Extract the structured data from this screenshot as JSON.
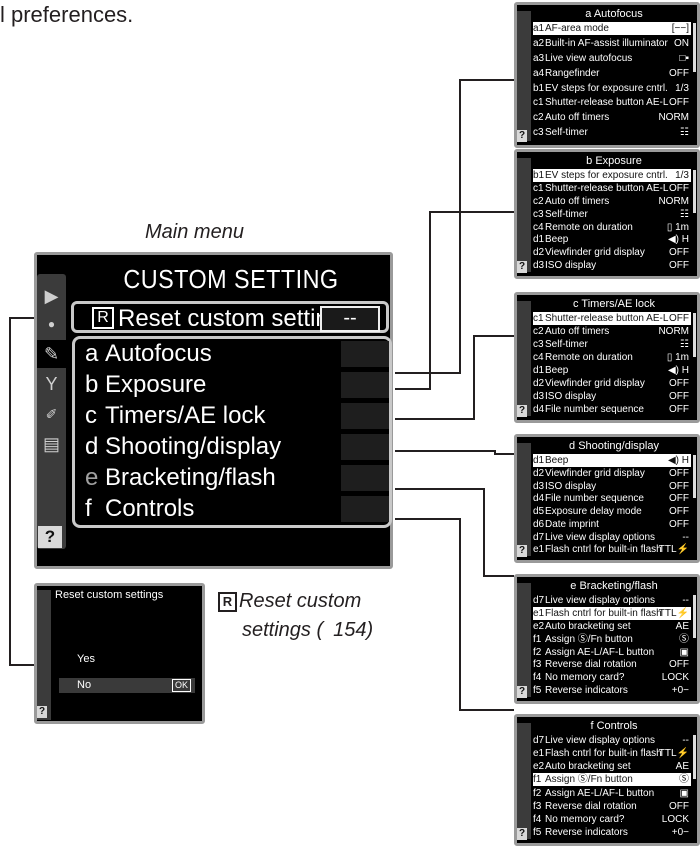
{
  "intro_text": "l preferences.",
  "main_caption": "Main menu",
  "main_menu": {
    "title": "CUSTOM SETTING MENU",
    "reset_label": "Reset custom settings",
    "reset_letter": "R",
    "reset_value": "--",
    "help": "?",
    "rows": [
      {
        "letter": "a",
        "label": "Autofocus"
      },
      {
        "letter": "b",
        "label": "Exposure"
      },
      {
        "letter": "c",
        "label": "Timers/AE lock"
      },
      {
        "letter": "d",
        "label": "Shooting/display"
      },
      {
        "letter": "e",
        "label": "Bracketing/flash"
      },
      {
        "letter": "f",
        "label": "Controls"
      }
    ]
  },
  "reset_popup": {
    "title": "Reset custom settings",
    "yes": "Yes",
    "no": "No",
    "ok": "OK",
    "help": "?"
  },
  "reset_caption": {
    "letter": "R",
    "line1": "Reset custom",
    "line2": "settings ( 154)",
    "book_icon": "book-icon"
  },
  "submenus": [
    {
      "title": "a Autofocus",
      "rows": [
        {
          "code": "a1",
          "label": "AF-area mode",
          "value": "[−−]",
          "selected": true
        },
        {
          "code": "a2",
          "label": "Built-in AF-assist illuminator",
          "value": "ON"
        },
        {
          "code": "a3",
          "label": "Live view autofocus",
          "value": "□▪"
        },
        {
          "code": "a4",
          "label": "Rangefinder",
          "value": "OFF"
        },
        {
          "code": "b1",
          "label": "EV steps for exposure cntrl.",
          "value": "1/3"
        },
        {
          "code": "c1",
          "label": "Shutter-release button AE-L",
          "value": "OFF"
        },
        {
          "code": "c2",
          "label": "Auto off timers",
          "value": "NORM"
        },
        {
          "code": "c3",
          "label": "Self-timer",
          "value": "☷"
        }
      ]
    },
    {
      "title": "b Exposure",
      "rows": [
        {
          "code": "b1",
          "label": "EV steps for exposure cntrl.",
          "value": "1/3",
          "selected": true
        },
        {
          "code": "c1",
          "label": "Shutter-release button AE-L",
          "value": "OFF"
        },
        {
          "code": "c2",
          "label": "Auto off timers",
          "value": "NORM"
        },
        {
          "code": "c3",
          "label": "Self-timer",
          "value": "☷"
        },
        {
          "code": "c4",
          "label": "Remote on duration",
          "value": "▯ 1m"
        },
        {
          "code": "d1",
          "label": "Beep",
          "value": "◀) H"
        },
        {
          "code": "d2",
          "label": "Viewfinder grid display",
          "value": "OFF"
        },
        {
          "code": "d3",
          "label": "ISO display",
          "value": "OFF"
        }
      ]
    },
    {
      "title": "c Timers/AE lock",
      "rows": [
        {
          "code": "c1",
          "label": "Shutter-release button AE-L",
          "value": "OFF",
          "selected": true
        },
        {
          "code": "c2",
          "label": "Auto off timers",
          "value": "NORM"
        },
        {
          "code": "c3",
          "label": "Self-timer",
          "value": "☷"
        },
        {
          "code": "c4",
          "label": "Remote on duration",
          "value": "▯ 1m"
        },
        {
          "code": "d1",
          "label": "Beep",
          "value": "◀) H"
        },
        {
          "code": "d2",
          "label": "Viewfinder grid display",
          "value": "OFF"
        },
        {
          "code": "d3",
          "label": "ISO display",
          "value": "OFF"
        },
        {
          "code": "d4",
          "label": "File number sequence",
          "value": "OFF"
        }
      ]
    },
    {
      "title": "d Shooting/display",
      "rows": [
        {
          "code": "d1",
          "label": "Beep",
          "value": "◀) H",
          "selected": true
        },
        {
          "code": "d2",
          "label": "Viewfinder grid display",
          "value": "OFF"
        },
        {
          "code": "d3",
          "label": "ISO display",
          "value": "OFF"
        },
        {
          "code": "d4",
          "label": "File number sequence",
          "value": "OFF"
        },
        {
          "code": "d5",
          "label": "Exposure delay mode",
          "value": "OFF"
        },
        {
          "code": "d6",
          "label": "Date imprint",
          "value": "OFF"
        },
        {
          "code": "d7",
          "label": "Live view display options",
          "value": "--"
        },
        {
          "code": "e1",
          "label": "Flash cntrl for built-in flash",
          "value": "TTL⚡"
        }
      ]
    },
    {
      "title": "e Bracketing/flash",
      "rows": [
        {
          "code": "d7",
          "label": "Live view display options",
          "value": "--"
        },
        {
          "code": "e1",
          "label": "Flash cntrl for built-in flash",
          "value": "TTL⚡",
          "selected": true
        },
        {
          "code": "e2",
          "label": "Auto bracketing set",
          "value": "AE"
        },
        {
          "code": "f1",
          "label": "Assign Ⓢ/Fn button",
          "value": "Ⓢ"
        },
        {
          "code": "f2",
          "label": "Assign AE-L/AF-L button",
          "value": "▣"
        },
        {
          "code": "f3",
          "label": "Reverse dial rotation",
          "value": "OFF"
        },
        {
          "code": "f4",
          "label": "No memory card?",
          "value": "LOCK"
        },
        {
          "code": "f5",
          "label": "Reverse indicators",
          "value": "+0−"
        }
      ]
    },
    {
      "title": "f Controls",
      "rows": [
        {
          "code": "d7",
          "label": "Live view display options",
          "value": "--"
        },
        {
          "code": "e1",
          "label": "Flash cntrl for built-in flash",
          "value": "TTL⚡"
        },
        {
          "code": "e2",
          "label": "Auto bracketing set",
          "value": "AE"
        },
        {
          "code": "f1",
          "label": "Assign Ⓢ/Fn button",
          "value": "Ⓢ",
          "selected": true
        },
        {
          "code": "f2",
          "label": "Assign AE-L/AF-L button",
          "value": "▣"
        },
        {
          "code": "f3",
          "label": "Reverse dial rotation",
          "value": "OFF"
        },
        {
          "code": "f4",
          "label": "No memory card?",
          "value": "LOCK"
        },
        {
          "code": "f5",
          "label": "Reverse indicators",
          "value": "+0−"
        }
      ]
    }
  ]
}
